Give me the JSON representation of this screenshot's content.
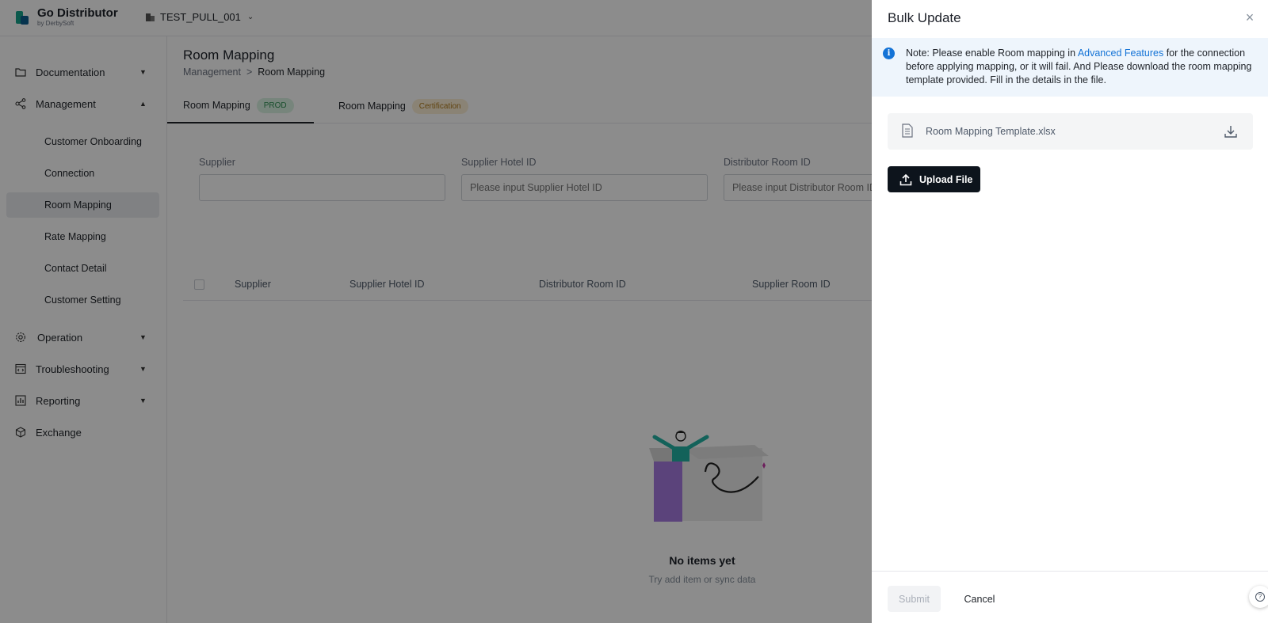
{
  "header": {
    "brand_title": "Go Distributor",
    "brand_sub": "by DerbySoft",
    "tenant": "TEST_PULL_001"
  },
  "sidebar": {
    "groups": [
      {
        "label": "Documentation",
        "icon": "folder-icon"
      },
      {
        "label": "Management",
        "icon": "share-nodes-icon"
      },
      {
        "label": "Operation",
        "icon": "gear-icon"
      },
      {
        "label": "Troubleshooting",
        "icon": "code-window-icon"
      },
      {
        "label": "Reporting",
        "icon": "report-chart-icon"
      },
      {
        "label": "Exchange",
        "icon": "hexagon-icon"
      }
    ],
    "management_items": [
      "Customer Onboarding",
      "Connection",
      "Room Mapping",
      "Rate Mapping",
      "Contact Detail",
      "Customer Setting"
    ],
    "active_item": "Room Mapping"
  },
  "main": {
    "title": "Room Mapping",
    "breadcrumb": {
      "parent": "Management",
      "separator": ">",
      "current": "Room Mapping"
    },
    "tabs": [
      {
        "label": "Room Mapping",
        "badge": "PROD"
      },
      {
        "label": "Room Mapping",
        "badge": "Certification"
      }
    ],
    "filters": [
      {
        "label": "Supplier",
        "placeholder": ""
      },
      {
        "label": "Supplier Hotel ID",
        "placeholder": "Please input Supplier Hotel ID"
      },
      {
        "label": "Distributor Room ID",
        "placeholder": "Please input Distributor Room ID"
      }
    ],
    "columns": [
      "Supplier",
      "Supplier Hotel ID",
      "Distributor Room ID",
      "Supplier Room ID"
    ],
    "empty": {
      "title": "No items yet",
      "subtitle": "Try add item or sync data"
    }
  },
  "drawer": {
    "title": "Bulk Update",
    "note_prefix": "Note: Please enable Room mapping in ",
    "note_link": "Advanced Features",
    "note_suffix": " for the connection before applying mapping, or it will fail. And Please download the room mapping template provided. Fill in the details in the file.",
    "template_file": "Room Mapping Template.xlsx",
    "upload_label": "Upload File",
    "submit_label": "Submit",
    "cancel_label": "Cancel",
    "help_glyph": "?"
  },
  "colors": {
    "accent": "#1473d6",
    "primary_button": "#0d141c",
    "prod_badge": "#2f8f52",
    "cert_badge": "#b07a1c"
  }
}
